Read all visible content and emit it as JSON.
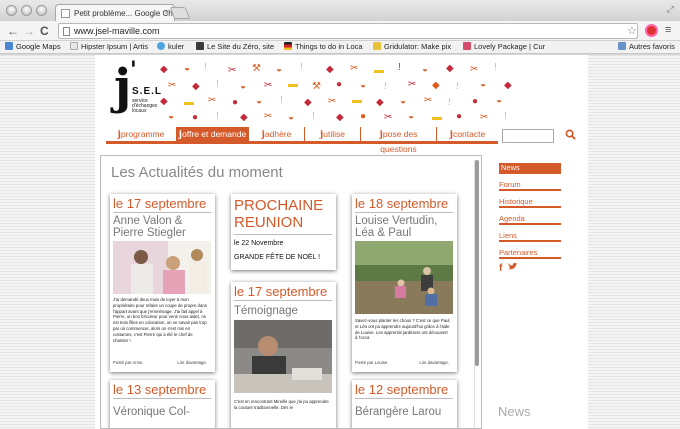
{
  "browser": {
    "tab_title": "Petit problème... Google Chr",
    "tab_close": "×",
    "url": "www.jsel-maville.com",
    "back": "←",
    "forward": "→",
    "reload": "C",
    "star": "☆",
    "menu": "≡",
    "resize": "⤢"
  },
  "bookmarks": [
    {
      "label": "Google Maps",
      "color": "#4a88d6"
    },
    {
      "label": "Hipster Ipsum | Artis",
      "color": "#e6e6e6"
    },
    {
      "label": "kuler",
      "color": "#4fa3e0"
    },
    {
      "label": "Le Site du Zéro, site",
      "color": "#3b3b3b"
    },
    {
      "label": "Things to do in Loca",
      "color": "#d0202a"
    },
    {
      "label": "Gridulator: Make pix",
      "color": "#e6c23a"
    },
    {
      "label": "Lovely Package | Cur",
      "color": "#d84a6a"
    },
    {
      "label": "Autres favoris",
      "color": "#6b93c8"
    }
  ],
  "logo": {
    "letter": "j",
    "apostrophe": "'",
    "name": "S.E.L",
    "subtitle": "service d'échanges locaux"
  },
  "nav": [
    {
      "j": "j",
      "label": "programme",
      "active": false
    },
    {
      "j": "j",
      "label": "offre et demande",
      "active": true
    },
    {
      "j": "j",
      "label": "adhère",
      "active": false
    },
    {
      "j": "j",
      "label": "utilise",
      "active": false
    },
    {
      "j": "j",
      "label": "pose des questions",
      "active": false
    },
    {
      "j": "j",
      "label": "contacte",
      "active": false
    }
  ],
  "feed": {
    "title": "Les Actualités du moment",
    "cards": [
      {
        "date": "le 17 septembre",
        "title": "Anne Valon & Pierre Stiegler",
        "text": "J'ai demandé deux mois de loyer à mon propriétaire pour refaire un coupe de propre dans l'appart avant que j'emménage. J'ai fait appel à Pierre, un bon bricoleur pour venir nous aider, on est trois filles en colocation, on ne savait pas trop par où commencer, alors on s'est mis en costumes, c'est Pierre qui a été le chef de chantier !",
        "posted": "Posté par Anne.",
        "more": "Lire davantage."
      },
      {
        "big_title": "PROCHAINE REUNION",
        "line1": "le 22 Novembre",
        "line2": "GRANDE FÊTE DE NOËL !"
      },
      {
        "date": "le 18 septembre",
        "title": "Louise Vertudin, Léa & Paul",
        "text": "Savez-vous planter les choux ? C'est ce que Paul et Léa ont pu apprendre aujourd'hui grâce à l'aide de Louise. Les apprentis jardiniers ont découvert à l'occa",
        "posted": "Posté par Louise.",
        "more": "Lire davantage."
      },
      {
        "date": "le 17 septembre",
        "title": "Témoignage",
        "text": "C'est en rencontrant Mireille que j'ai pu apprendre la couture traditionnelle. Dès le"
      },
      {
        "date": "le 13 septembre",
        "title": "Véronique Col-"
      },
      {
        "date": "le 12 septembre",
        "title": "Bérangère Larou"
      }
    ]
  },
  "sidebar": {
    "items": [
      "News",
      "Forum",
      "Historique",
      "Agenda",
      "Liens",
      "Partenaires"
    ],
    "social": "f",
    "footer_heading": "News"
  },
  "colors": {
    "accent": "#d45a2a",
    "text_grey": "#777777"
  }
}
